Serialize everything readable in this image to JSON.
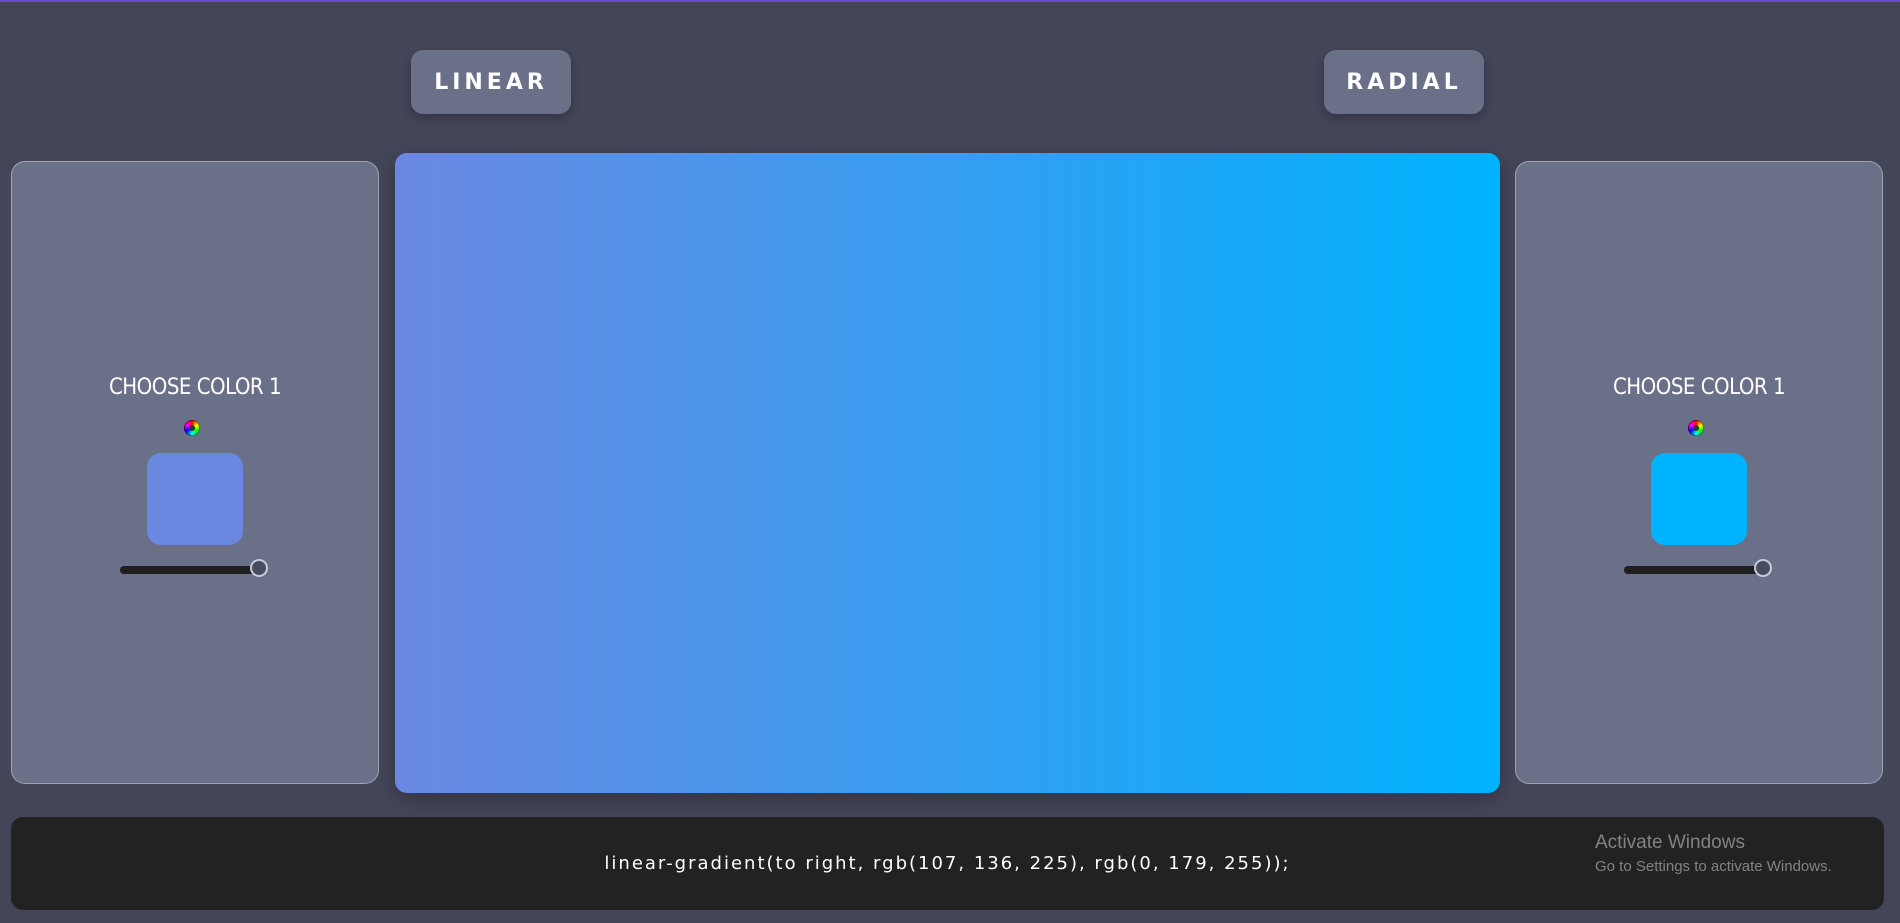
{
  "buttons": {
    "linear_label": "LINEAR",
    "radial_label": "RADIAL"
  },
  "panels": {
    "left": {
      "title": "CHOOSE COLOR 1",
      "color": "#6b88e1",
      "slider_value": 1.0
    },
    "right": {
      "title": "CHOOSE COLOR 1",
      "color": "#00b3ff",
      "slider_value": 1.0
    }
  },
  "preview": {
    "gradient_css": "linear-gradient(to right, rgb(107, 136, 225), rgb(0, 179, 255))"
  },
  "code": {
    "text": "linear-gradient(to right, rgb(107, 136, 225), rgb(0, 179, 255));"
  },
  "watermark": {
    "title": "Activate Windows",
    "subtitle": "Go to Settings to activate Windows."
  },
  "colors": {
    "background": "#434559",
    "panel": "#6b7089",
    "accent_line": "#6a4bd3",
    "code_bar": "#222222"
  }
}
